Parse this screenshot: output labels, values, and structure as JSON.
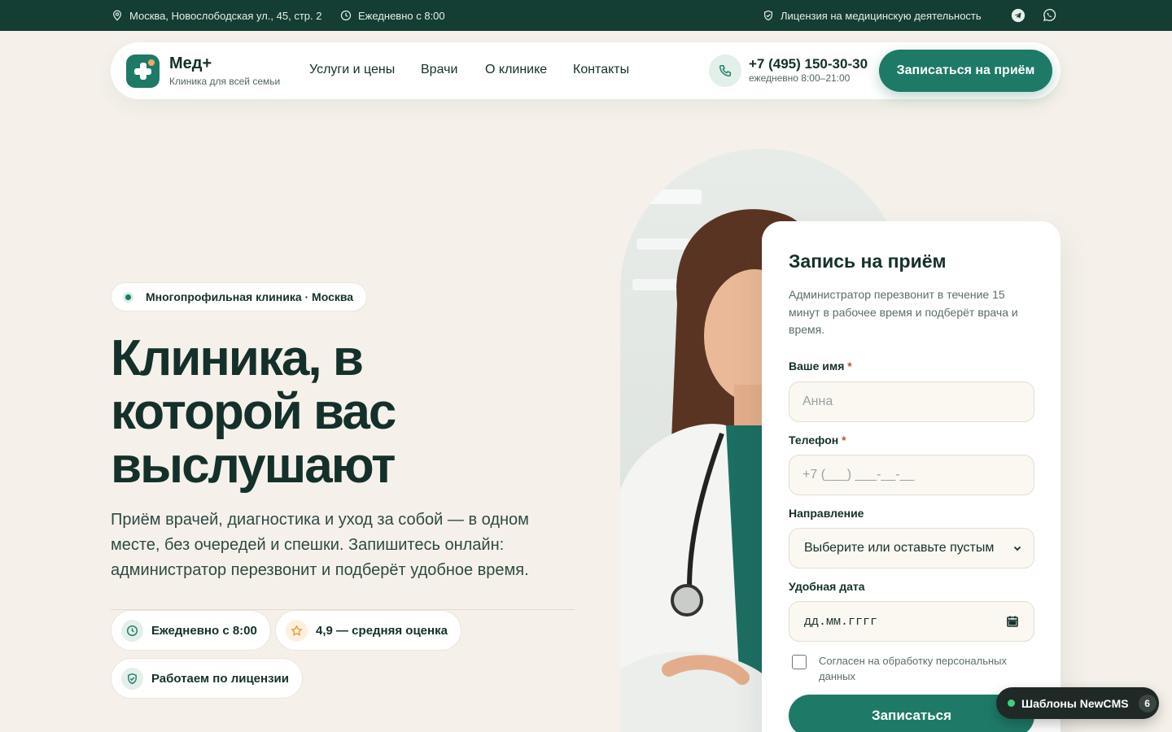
{
  "topbar": {
    "address": "Москва, Новослободская ул., 45, стр. 2",
    "hours": "Ежедневно с 8:00",
    "license": "Лицензия на медицинскую деятельность"
  },
  "header": {
    "logo_name": "Мед+",
    "logo_sub": "Клиника для всей семьи",
    "nav": [
      "Услуги и цены",
      "Врачи",
      "О клинике",
      "Контакты"
    ],
    "phone": "+7 (495) 150-30-30",
    "phone_hours": "ежедневно 8:00–21:00",
    "cta_label": "Записаться на приём"
  },
  "hero": {
    "badge": "Многопрофильная клиника · Москва",
    "title_lines": [
      "Клиника, в",
      "которой вас",
      "выслушают"
    ],
    "desc_lines": [
      "Приём врачей, диагностика и уход за собой — в одном",
      "месте, без очередей и спешки. Запишитесь онлайн:",
      "администратор перезвонит и подберёт удобное время."
    ],
    "features": [
      {
        "label": "Ежедневно с 8:00",
        "icon": "clock-icon"
      },
      {
        "label": "4,9 — средняя оценка",
        "icon": "star-icon"
      },
      {
        "label": "Работаем по лицензии",
        "icon": "shield-check-icon"
      }
    ]
  },
  "form": {
    "title": "Запись на приём",
    "desc_lines": [
      "Администратор перезвонит в течение 15",
      "минут в рабочее время и подберёт врача и",
      "время."
    ],
    "name_label": "Ваше имя",
    "name_placeholder": "Анна",
    "phone_label": "Телефон",
    "phone_placeholder": "+7 (___) ___-__-__",
    "direction_label": "Направление",
    "direction_value": "Выберите или оставьте пустым",
    "date_label": "Удобная дата",
    "date_placeholder": "дд.мм.гггг",
    "required_mark": "*",
    "consent_lines": [
      "Согласен на обработку персональных",
      "данных"
    ],
    "submit_label": "Записаться"
  },
  "floating": {
    "label": "Шаблоны NewCMS",
    "count": "6"
  },
  "colors": {
    "primary": "#1e7a67",
    "topbar": "#143d33",
    "background": "#f5f1ea",
    "accent": "#f0a86a"
  }
}
